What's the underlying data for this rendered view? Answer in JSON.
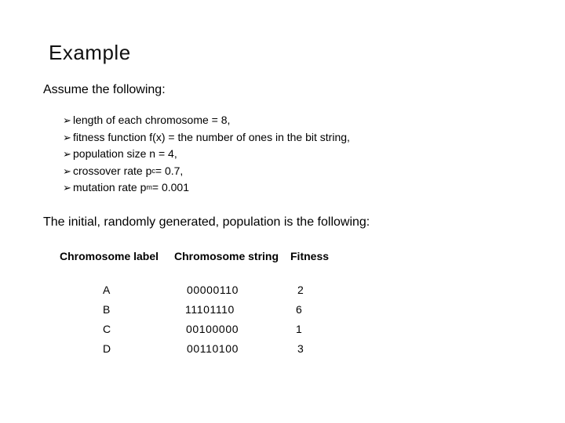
{
  "slide": {
    "title": "Example",
    "intro": "Assume the following:",
    "assumptions": [
      {
        "text": "length of each chromosome = 8,",
        "sub": "",
        "after": ""
      },
      {
        "text": "fitness function f(x) =  the number of ones in the bit string,",
        "sub": "",
        "after": ""
      },
      {
        "text": "population size n  =  4,",
        "sub": "",
        "after": ""
      },
      {
        "text": "crossover rate p",
        "sub": "c",
        "after": " = 0.7,"
      },
      {
        "text": "mutation rate p",
        "sub": "m",
        "after": " = 0.001"
      }
    ],
    "bullet_icon": "➢",
    "population_intro": "The initial, randomly generated, population is the following:",
    "table": {
      "headers": [
        "Chromosome label",
        "Chromosome string",
        "Fitness"
      ],
      "rows": [
        {
          "label": "A",
          "string": "00000110",
          "fitness": "2"
        },
        {
          "label": "B",
          "string": "11101110",
          "fitness": "6"
        },
        {
          "label": "C",
          "string": "00100000",
          "fitness": "1"
        },
        {
          "label": "D",
          "string": "00110100",
          "fitness": "3"
        }
      ]
    }
  }
}
